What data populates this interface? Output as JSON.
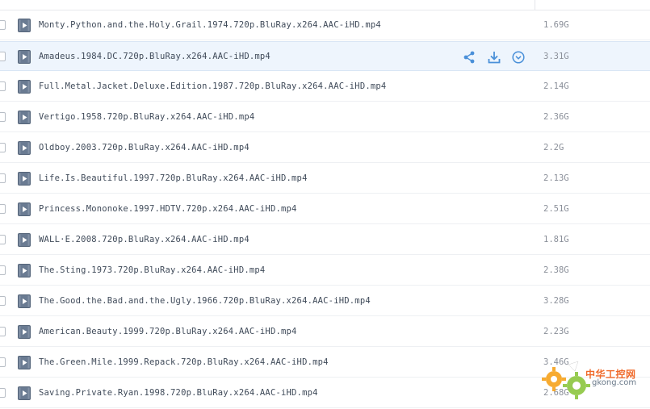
{
  "files": [
    {
      "name": "Monty.Python.and.the.Holy.Grail.1974.720p.BluRay.x264.AAC-iHD.mp4",
      "size": "1.69G"
    },
    {
      "name": "Amadeus.1984.DC.720p.BluRay.x264.AAC-iHD.mp4",
      "size": "3.31G"
    },
    {
      "name": "Full.Metal.Jacket.Deluxe.Edition.1987.720p.BluRay.x264.AAC-iHD.mp4",
      "size": "2.14G"
    },
    {
      "name": "Vertigo.1958.720p.BluRay.x264.AAC-iHD.mp4",
      "size": "2.36G"
    },
    {
      "name": "Oldboy.2003.720p.BluRay.x264.AAC-iHD.mp4",
      "size": "2.2G"
    },
    {
      "name": "Life.Is.Beautiful.1997.720p.BluRay.x264.AAC-iHD.mp4",
      "size": "2.13G"
    },
    {
      "name": "Princess.Mononoke.1997.HDTV.720p.x264.AAC-iHD.mp4",
      "size": "2.51G"
    },
    {
      "name": "WALL·E.2008.720p.BluRay.x264.AAC-iHD.mp4",
      "size": "1.81G"
    },
    {
      "name": "The.Sting.1973.720p.BluRay.x264.AAC-iHD.mp4",
      "size": "2.38G"
    },
    {
      "name": "The.Good.the.Bad.and.the.Ugly.1966.720p.BluRay.x264.AAC-iHD.mp4",
      "size": "3.28G"
    },
    {
      "name": "American.Beauty.1999.720p.BluRay.x264.AAC-iHD.mp4",
      "size": "2.23G"
    },
    {
      "name": "The.Green.Mile.1999.Repack.720p.BluRay.x264.AAC-iHD.mp4",
      "size": "3.46G"
    },
    {
      "name": "Saving.Private.Ryan.1998.720p.BluRay.x264.AAC-iHD.mp4",
      "size": "2.68G"
    }
  ],
  "hovered_index": 1,
  "row_actions": [
    "share-icon",
    "download-icon",
    "more-dropdown-icon"
  ],
  "icons": {
    "file": "video-file-icon"
  },
  "colors": {
    "row_hover_bg": "#eef5fd",
    "action_blue": "#4a90d9",
    "file_icon_bg": "#6a7b92",
    "text": "#3f4a59",
    "size_text": "#8a8f99"
  },
  "watermark": {
    "cn": "中华工控网",
    "en": "gkong.com"
  }
}
